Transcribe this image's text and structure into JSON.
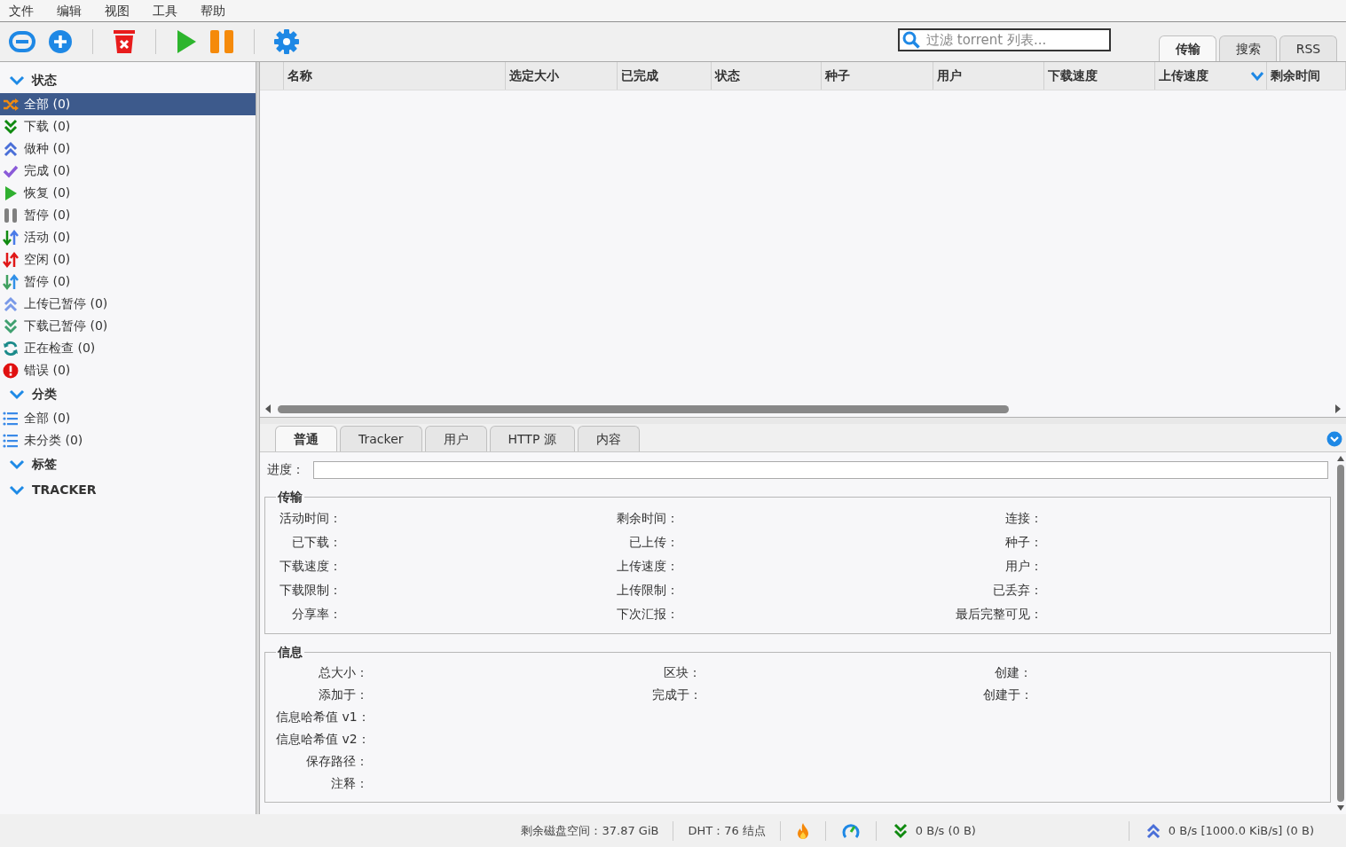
{
  "menu": [
    "文件",
    "编辑",
    "视图",
    "工具",
    "帮助"
  ],
  "toolbar": [
    {
      "kind": "link"
    },
    {
      "kind": "add"
    },
    {
      "kind": "sep"
    },
    {
      "kind": "delete"
    },
    {
      "kind": "sep"
    },
    {
      "kind": "resume"
    },
    {
      "kind": "pause"
    },
    {
      "kind": "sep"
    },
    {
      "kind": "settings"
    }
  ],
  "filter": {
    "placeholder": "过滤 torrent 列表..."
  },
  "main_tabs": [
    {
      "label": "传输",
      "selected": true
    },
    {
      "label": "搜索",
      "selected": false
    },
    {
      "label": "RSS",
      "selected": false
    }
  ],
  "sidebar": [
    {
      "title": "状态",
      "expanded": true,
      "items": [
        {
          "kind": "all",
          "label": "全部 (0)",
          "selected": true
        },
        {
          "kind": "downloading",
          "label": "下载 (0)",
          "selected": false
        },
        {
          "kind": "seeding",
          "label": "做种 (0)",
          "selected": false
        },
        {
          "kind": "completed",
          "label": "完成 (0)",
          "selected": false
        },
        {
          "kind": "resumed",
          "label": "恢复 (0)",
          "selected": false
        },
        {
          "kind": "paused",
          "label": "暂停 (0)",
          "selected": false
        },
        {
          "kind": "active",
          "label": "活动 (0)",
          "selected": false
        },
        {
          "kind": "inactive",
          "label": "空闲 (0)",
          "selected": false
        },
        {
          "kind": "stalled",
          "label": "暂停 (0)",
          "selected": false
        },
        {
          "kind": "upload_paused",
          "label": "上传已暂停 (0)",
          "selected": false
        },
        {
          "kind": "download_paused",
          "label": "下载已暂停 (0)",
          "selected": false
        },
        {
          "kind": "checking",
          "label": "正在检查 (0)",
          "selected": false
        },
        {
          "kind": "errored",
          "label": "错误 (0)",
          "selected": false
        }
      ]
    },
    {
      "title": "分类",
      "expanded": true,
      "items": [
        {
          "kind": "list",
          "label": "全部 (0)",
          "selected": false
        },
        {
          "kind": "list",
          "label": "未分类 (0)",
          "selected": false
        }
      ]
    },
    {
      "title": "标签",
      "expanded": true
    },
    {
      "title": "TRACKER",
      "expanded": true
    }
  ],
  "table": {
    "columns": [
      {
        "label": "名称",
        "sorted": false
      },
      {
        "label": "选定大小",
        "sorted": false
      },
      {
        "label": "已完成",
        "sorted": false
      },
      {
        "label": "状态",
        "sorted": false
      },
      {
        "label": "种子",
        "sorted": false
      },
      {
        "label": "用户",
        "sorted": false
      },
      {
        "label": "下载速度",
        "sorted": false
      },
      {
        "label": "上传速度",
        "sorted": true
      },
      {
        "label": "剩余时间",
        "sorted": false
      }
    ]
  },
  "detail_tabs": [
    {
      "label": "普通",
      "selected": true
    },
    {
      "label": "Tracker",
      "selected": false
    },
    {
      "label": "用户",
      "selected": false
    },
    {
      "label": "HTTP 源",
      "selected": false
    },
    {
      "label": "内容",
      "selected": false
    }
  ],
  "progress": {
    "label": "进度：",
    "level": 0
  },
  "transfer": {
    "title": "传输",
    "rows": [
      [
        "活动时间：",
        "剩余时间：",
        "连接："
      ],
      [
        "已下载：",
        "已上传：",
        "种子："
      ],
      [
        "下载速度：",
        "上传速度：",
        "用户："
      ],
      [
        "下载限制：",
        "上传限制：",
        "已丢弃："
      ],
      [
        "分享率：",
        "下次汇报：",
        "最后完整可见："
      ]
    ]
  },
  "info": {
    "title": "信息",
    "rows": [
      [
        "总大小：",
        "区块：",
        "创建："
      ],
      [
        "添加于：",
        "完成于：",
        "创建于："
      ],
      [
        "信息哈希值 v1："
      ],
      [
        "信息哈希值 v2："
      ],
      [
        "保存路径："
      ],
      [
        "注释："
      ]
    ]
  },
  "status_bar": {
    "disk": "剩余磁盘空间：37.87 GiB",
    "dht": "DHT：76 结点",
    "download": "0 B/s (0 B)",
    "upload": "0 B/s [1000.0 KiB/s] (0 B)"
  }
}
